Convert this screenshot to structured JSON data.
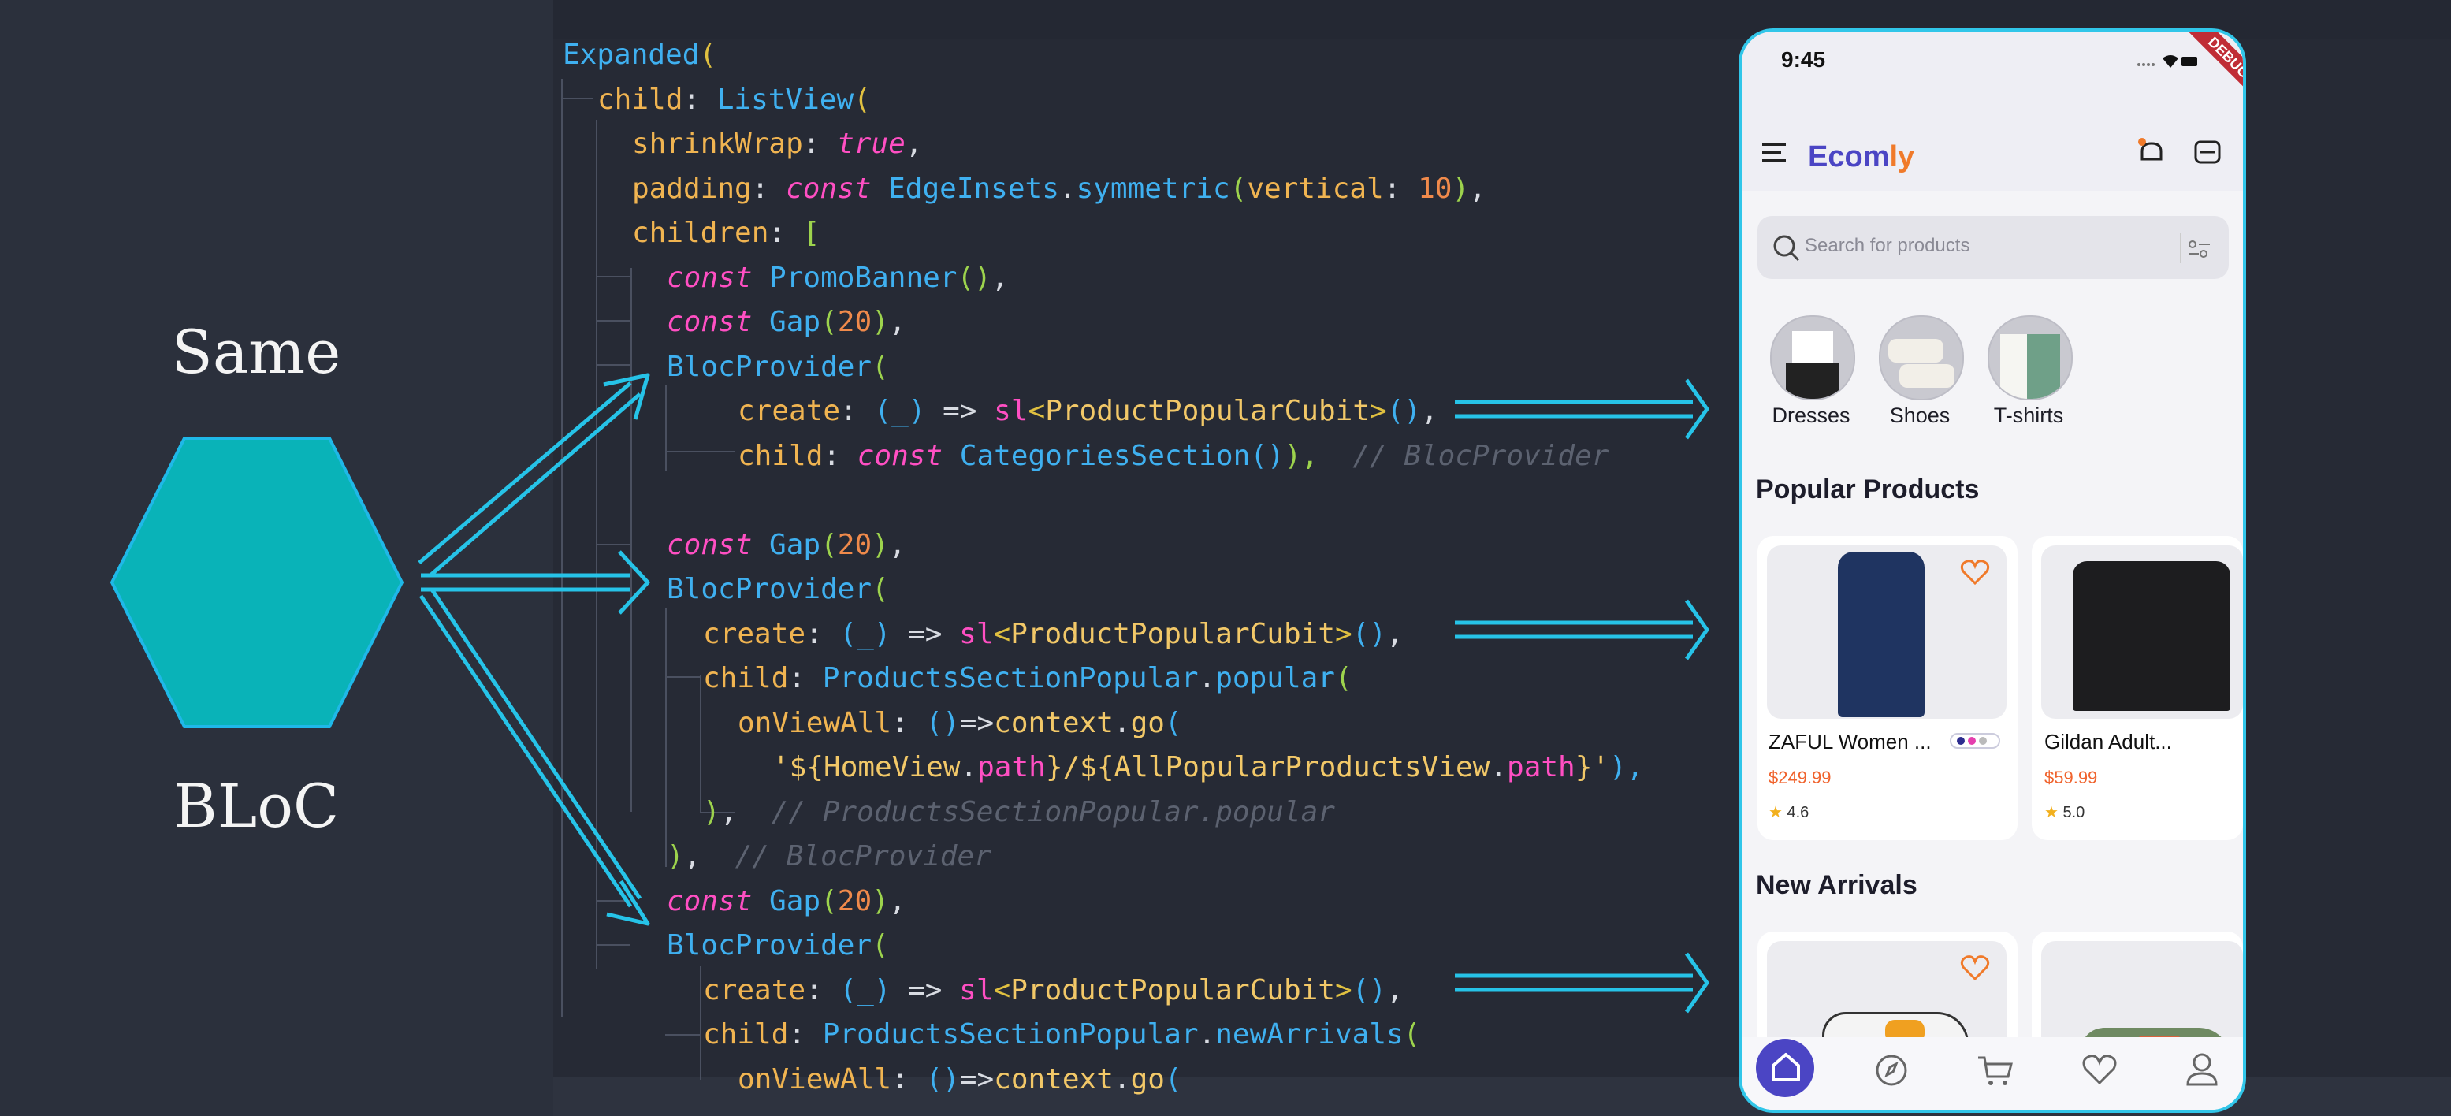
{
  "left": {
    "top_label": "Same",
    "bottom_label": "BLoC",
    "hexagon_color": "#09b3b8",
    "arrow_color": "#26c3e8"
  },
  "code": {
    "lines": [
      {
        "tokens": [
          {
            "t": "Expanded",
            "c": "type"
          },
          {
            "t": "(",
            "c": "paren"
          }
        ]
      },
      {
        "tokens": [
          {
            "t": "child",
            "c": "prop"
          },
          {
            "t": ": ",
            "c": "dim"
          },
          {
            "t": "ListView",
            "c": "type"
          },
          {
            "t": "(",
            "c": "paren"
          }
        ]
      },
      {
        "tokens": [
          {
            "t": "shrinkWrap",
            "c": "prop"
          },
          {
            "t": ": ",
            "c": "dim"
          },
          {
            "t": "true",
            "c": "kw"
          },
          {
            "t": ",",
            "c": "dim"
          }
        ]
      },
      {
        "tokens": [
          {
            "t": "padding",
            "c": "prop"
          },
          {
            "t": ": ",
            "c": "dim"
          },
          {
            "t": "const ",
            "c": "kw"
          },
          {
            "t": "EdgeInsets",
            "c": "type"
          },
          {
            "t": ".",
            "c": "dim"
          },
          {
            "t": "symmetric",
            "c": "type"
          },
          {
            "t": "(",
            "c": "br"
          },
          {
            "t": "vertical",
            "c": "prop"
          },
          {
            "t": ": ",
            "c": "dim"
          },
          {
            "t": "10",
            "c": "num"
          },
          {
            "t": ")",
            "c": "br"
          },
          {
            "t": ",",
            "c": "dim"
          }
        ]
      },
      {
        "tokens": [
          {
            "t": "children",
            "c": "prop"
          },
          {
            "t": ": ",
            "c": "dim"
          },
          {
            "t": "[",
            "c": "br"
          }
        ]
      },
      {
        "tokens": [
          {
            "t": "const ",
            "c": "kw"
          },
          {
            "t": "PromoBanner",
            "c": "type"
          },
          {
            "t": "()",
            "c": "br"
          },
          {
            "t": ",",
            "c": "dim"
          }
        ]
      },
      {
        "tokens": [
          {
            "t": "const ",
            "c": "kw"
          },
          {
            "t": "Gap",
            "c": "type"
          },
          {
            "t": "(",
            "c": "br"
          },
          {
            "t": "20",
            "c": "num"
          },
          {
            "t": ")",
            "c": "br"
          },
          {
            "t": ",",
            "c": "dim"
          }
        ]
      },
      {
        "tokens": [
          {
            "t": "BlocProvider",
            "c": "type"
          },
          {
            "t": "(",
            "c": "br"
          }
        ]
      },
      {
        "tokens": [
          {
            "t": "create",
            "c": "prop"
          },
          {
            "t": ": ",
            "c": "dim"
          },
          {
            "t": "(_)",
            "c": "type"
          },
          {
            "t": " => ",
            "c": "dim"
          },
          {
            "t": "sl",
            "c": "kw2"
          },
          {
            "t": "<",
            "c": "paren"
          },
          {
            "t": "ProductPopularCubit",
            "c": "str"
          },
          {
            "t": ">",
            "c": "paren"
          },
          {
            "t": "()",
            "c": "type"
          },
          {
            "t": ",",
            "c": "dim"
          }
        ]
      },
      {
        "tokens": [
          {
            "t": "child",
            "c": "prop"
          },
          {
            "t": ": ",
            "c": "dim"
          },
          {
            "t": "const ",
            "c": "kw"
          },
          {
            "t": "CategoriesSection",
            "c": "type"
          },
          {
            "t": "()",
            "c": "type"
          },
          {
            "t": "),",
            "c": "br"
          },
          {
            "t": "  // BlocProvider",
            "c": "cmt"
          }
        ]
      },
      {
        "tokens": []
      },
      {
        "tokens": [
          {
            "t": "const ",
            "c": "kw"
          },
          {
            "t": "Gap",
            "c": "type"
          },
          {
            "t": "(",
            "c": "br"
          },
          {
            "t": "20",
            "c": "num"
          },
          {
            "t": ")",
            "c": "br"
          },
          {
            "t": ",",
            "c": "dim"
          }
        ]
      },
      {
        "tokens": [
          {
            "t": "BlocProvider",
            "c": "type"
          },
          {
            "t": "(",
            "c": "br"
          }
        ]
      },
      {
        "tokens": [
          {
            "t": "create",
            "c": "prop"
          },
          {
            "t": ": ",
            "c": "dim"
          },
          {
            "t": "(_)",
            "c": "type"
          },
          {
            "t": " => ",
            "c": "dim"
          },
          {
            "t": "sl",
            "c": "kw2"
          },
          {
            "t": "<",
            "c": "paren"
          },
          {
            "t": "ProductPopularCubit",
            "c": "str"
          },
          {
            "t": ">",
            "c": "paren"
          },
          {
            "t": "()",
            "c": "type"
          },
          {
            "t": ",",
            "c": "dim"
          }
        ]
      },
      {
        "tokens": [
          {
            "t": "child",
            "c": "prop"
          },
          {
            "t": ": ",
            "c": "dim"
          },
          {
            "t": "ProductsSectionPopular",
            "c": "type"
          },
          {
            "t": ".",
            "c": "dim"
          },
          {
            "t": "popular",
            "c": "type"
          },
          {
            "t": "(",
            "c": "br"
          }
        ]
      },
      {
        "tokens": [
          {
            "t": "onViewAll",
            "c": "prop"
          },
          {
            "t": ": ",
            "c": "dim"
          },
          {
            "t": "()",
            "c": "type"
          },
          {
            "t": "=>",
            "c": "dim"
          },
          {
            "t": "context",
            "c": "str"
          },
          {
            "t": ".",
            "c": "dim"
          },
          {
            "t": "go",
            "c": "str"
          },
          {
            "t": "(",
            "c": "type"
          }
        ]
      },
      {
        "tokens": [
          {
            "t": "'${",
            "c": "str"
          },
          {
            "t": "HomeView",
            "c": "str"
          },
          {
            "t": ".",
            "c": "dim"
          },
          {
            "t": "path",
            "c": "kw2"
          },
          {
            "t": "}/${",
            "c": "str"
          },
          {
            "t": "AllPopularProductsView",
            "c": "str"
          },
          {
            "t": ".",
            "c": "dim"
          },
          {
            "t": "path",
            "c": "kw2"
          },
          {
            "t": "}'",
            "c": "str"
          },
          {
            "t": "),",
            "c": "type"
          }
        ]
      },
      {
        "tokens": [
          {
            "t": ")",
            "c": "br"
          },
          {
            "t": ",  ",
            "c": "dim"
          },
          {
            "t": "// ProductsSectionPopular.popular",
            "c": "cmt"
          }
        ]
      },
      {
        "tokens": [
          {
            "t": ")",
            "c": "br"
          },
          {
            "t": ",  ",
            "c": "dim"
          },
          {
            "t": "// BlocProvider",
            "c": "cmt"
          }
        ]
      },
      {
        "tokens": [
          {
            "t": "const ",
            "c": "kw"
          },
          {
            "t": "Gap",
            "c": "type"
          },
          {
            "t": "(",
            "c": "br"
          },
          {
            "t": "20",
            "c": "num"
          },
          {
            "t": ")",
            "c": "br"
          },
          {
            "t": ",",
            "c": "dim"
          }
        ]
      },
      {
        "tokens": [
          {
            "t": "BlocProvider",
            "c": "type"
          },
          {
            "t": "(",
            "c": "br"
          }
        ]
      },
      {
        "tokens": [
          {
            "t": "create",
            "c": "prop"
          },
          {
            "t": ": ",
            "c": "dim"
          },
          {
            "t": "(_)",
            "c": "type"
          },
          {
            "t": " => ",
            "c": "dim"
          },
          {
            "t": "sl",
            "c": "kw2"
          },
          {
            "t": "<",
            "c": "paren"
          },
          {
            "t": "ProductPopularCubit",
            "c": "str"
          },
          {
            "t": ">",
            "c": "paren"
          },
          {
            "t": "()",
            "c": "type"
          },
          {
            "t": ",",
            "c": "dim"
          }
        ]
      },
      {
        "tokens": [
          {
            "t": "child",
            "c": "prop"
          },
          {
            "t": ": ",
            "c": "dim"
          },
          {
            "t": "ProductsSectionPopular",
            "c": "type"
          },
          {
            "t": ".",
            "c": "dim"
          },
          {
            "t": "newArrivals",
            "c": "type"
          },
          {
            "t": "(",
            "c": "br"
          }
        ]
      },
      {
        "tokens": [
          {
            "t": "onViewAll",
            "c": "prop"
          },
          {
            "t": ": ",
            "c": "dim"
          },
          {
            "t": "()",
            "c": "type"
          },
          {
            "t": "=>",
            "c": "dim"
          },
          {
            "t": "context",
            "c": "str"
          },
          {
            "t": ".",
            "c": "dim"
          },
          {
            "t": "go",
            "c": "str"
          },
          {
            "t": "(",
            "c": "type"
          }
        ]
      }
    ]
  },
  "phone": {
    "time": "9:45",
    "debug_banner": "DEBUG",
    "brand_part1": "Ecom",
    "brand_part2": "ly",
    "brand_color1": "#4b45c4",
    "brand_color2": "#f07a2a",
    "search_placeholder": "Search for products",
    "categories": [
      {
        "label": "Dresses",
        "icon": "dress-thumbnail"
      },
      {
        "label": "Shoes",
        "icon": "shoes-thumbnail"
      },
      {
        "label": "T-shirts",
        "icon": "tshirt-thumbnail"
      }
    ],
    "popular_title": "Popular Products",
    "popular_products": [
      {
        "name": "ZAFUL Women ...",
        "price": "$249.99",
        "rating": "4.6"
      },
      {
        "name": "Gildan Adult...",
        "price": "$59.99",
        "rating": "5.0"
      }
    ],
    "new_arrivals_title": "New Arrivals",
    "nav_icons": [
      "home-icon",
      "compass-icon",
      "cart-icon",
      "heart-icon",
      "profile-icon"
    ]
  }
}
